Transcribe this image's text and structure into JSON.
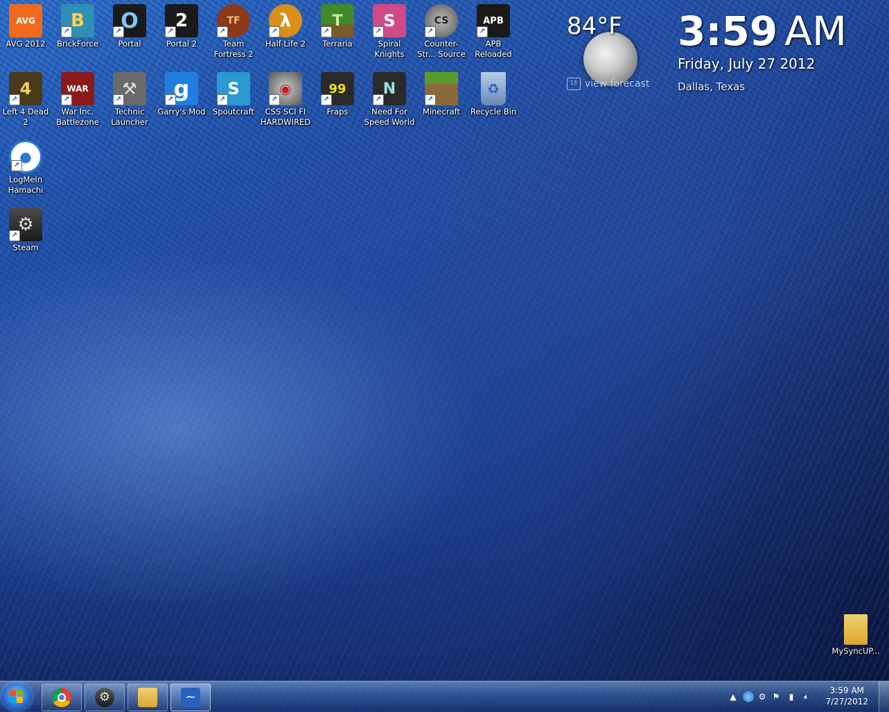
{
  "desktop_icons": [
    {
      "label": "AVG 2012",
      "icon": "avg-icon",
      "bg": "#f06a1e",
      "glyph": "AVG",
      "shortcut": false
    },
    {
      "label": "BrickForce",
      "icon": "brickforce-icon",
      "bg": "#2f8fb5",
      "glyph": "B",
      "shortcut": true
    },
    {
      "label": "Portal",
      "icon": "portal-icon",
      "bg": "#1a1a1a",
      "glyph": "O",
      "shortcut": true
    },
    {
      "label": "Portal 2",
      "icon": "portal2-icon",
      "bg": "#1a1a1a",
      "glyph": "2",
      "shortcut": true
    },
    {
      "label": "Team Fortress 2",
      "icon": "tf2-icon",
      "bg": "#8a3a16",
      "glyph": "TF",
      "shortcut": true
    },
    {
      "label": "Half-Life 2",
      "icon": "halflife2-icon",
      "bg": "#d9901a",
      "glyph": "λ",
      "shortcut": true
    },
    {
      "label": "Terraria",
      "icon": "terraria-icon",
      "bg": "#3f8a2a",
      "glyph": "T",
      "shortcut": true
    },
    {
      "label": "Spiral Knights",
      "icon": "spiral-knights-icon",
      "bg": "#d04a8a",
      "glyph": "S",
      "shortcut": true
    },
    {
      "label": "Counter-Str... Source",
      "icon": "css-icon",
      "bg": "#7a7a7a",
      "glyph": "CS",
      "shortcut": true
    },
    {
      "label": "APB Reloaded",
      "icon": "apb-icon",
      "bg": "#1a1a1a",
      "glyph": "APB",
      "shortcut": true
    },
    {
      "label": "Left 4 Dead 2",
      "icon": "l4d2-icon",
      "bg": "#4a3a1a",
      "glyph": "4",
      "shortcut": true
    },
    {
      "label": "War Inc. Battlezone",
      "icon": "warinc-icon",
      "bg": "#8a1a1a",
      "glyph": "WAR",
      "shortcut": true
    },
    {
      "label": "Technic Launcher",
      "icon": "technic-icon",
      "bg": "#6a6a6a",
      "glyph": "⚒",
      "shortcut": true
    },
    {
      "label": "Garry's Mod",
      "icon": "gmod-icon",
      "bg": "#1f7ee0",
      "glyph": "g",
      "shortcut": true
    },
    {
      "label": "Spoutcraft",
      "icon": "spoutcraft-icon",
      "bg": "#2a9ad0",
      "glyph": "S",
      "shortcut": true
    },
    {
      "label": "CSS SCI FI HARDWIRED",
      "icon": "css-scifi-icon",
      "bg": "#8a8a8a",
      "glyph": "◉",
      "shortcut": true
    },
    {
      "label": "Fraps",
      "icon": "fraps-icon",
      "bg": "#2a2a2a",
      "glyph": "99",
      "shortcut": true
    },
    {
      "label": "Need For Speed World",
      "icon": "nfs-icon",
      "bg": "#2a2a2a",
      "glyph": "N",
      "shortcut": true
    },
    {
      "label": "Minecraft",
      "icon": "minecraft-icon",
      "bg": "#5a8a2a",
      "glyph": "■",
      "shortcut": true
    },
    {
      "label": "Recycle Bin",
      "icon": "recycle-bin-icon",
      "bg": "#9ab4d4",
      "glyph": "♻",
      "shortcut": false
    },
    {
      "label": "LogMeIn Hamachi",
      "icon": "hamachi-icon",
      "bg": "#2a7ad0",
      "glyph": "●",
      "shortcut": true
    },
    {
      "label": "Steam",
      "icon": "steam-icon",
      "bg": "#2a2a2a",
      "glyph": "⚙",
      "shortcut": true
    },
    {
      "label": "MySyncUP...",
      "icon": "folder-icon",
      "bg": "#e8c050",
      "glyph": "",
      "shortcut": false
    }
  ],
  "weather": {
    "temperature": "84°F",
    "forecast_label": "view forecast",
    "calendar_day": "15"
  },
  "clock": {
    "time": "3:59",
    "ampm": "AM",
    "date": "Friday, July 27 2012",
    "city": "Dallas, Texas"
  },
  "taskbar": {
    "pinned": [
      {
        "name": "chrome",
        "icon": "chrome-icon",
        "color": "#d63a2a"
      },
      {
        "name": "steam",
        "icon": "steam-icon",
        "color": "#3a3a3a"
      },
      {
        "name": "explorer",
        "icon": "folder-icon",
        "color": "#e8c050"
      },
      {
        "name": "messenger",
        "icon": "messenger-icon",
        "color": "#3a70c8"
      }
    ],
    "tray_time": "3:59 AM",
    "tray_date": "7/27/2012"
  }
}
